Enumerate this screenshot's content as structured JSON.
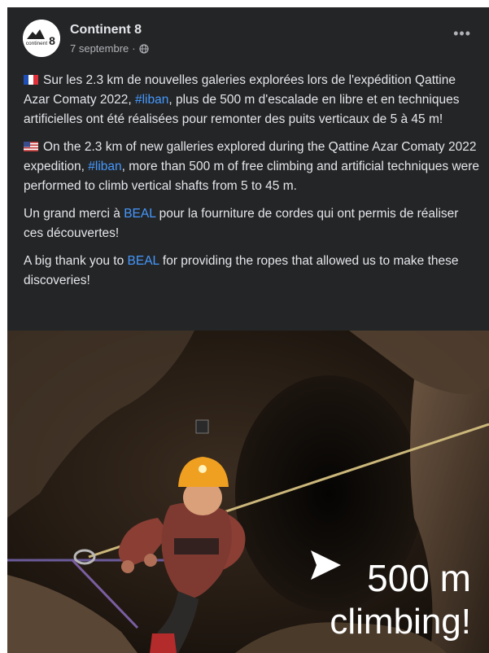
{
  "post": {
    "author": "Continent 8",
    "date": "7 septembre",
    "more_label": "•••",
    "paragraphs": {
      "fr": {
        "before": "Sur les 2.3 km de nouvelles galeries explorées lors de l'expédition Qattine Azar Comaty 2022, ",
        "tag": "#liban",
        "after": ", plus de 500 m d'escalade en libre et en techniques artificielles ont été réalisées pour remonter des puits verticaux de 5 à 45 m!"
      },
      "en": {
        "before": "On the 2.3 km of new galleries explored during the Qattine Azar Comaty 2022 expedition, ",
        "tag": "#liban",
        "after": ", more than 500 m of free climbing and artificial techniques were performed to climb vertical shafts from 5 to 45 m."
      },
      "thanks_fr": {
        "before": "Un grand merci à ",
        "tag": "BEAL",
        "after": " pour la fourniture de cordes qui ont permis de réaliser ces découvertes!"
      },
      "thanks_en": {
        "before": "A big thank you to  ",
        "tag": "BEAL",
        "after": " for providing the ropes that allowed us to make these discoveries!"
      }
    },
    "photo": {
      "overlay_line1": "500 m",
      "overlay_line2": "climbing!"
    },
    "logo": {
      "text": "continent",
      "number": "8"
    }
  },
  "colors": {
    "card_bg": "#242526",
    "text": "#e4e6eb",
    "secondary": "#b0b3b8",
    "link": "#4599ff",
    "helmet": "#f0a020"
  }
}
